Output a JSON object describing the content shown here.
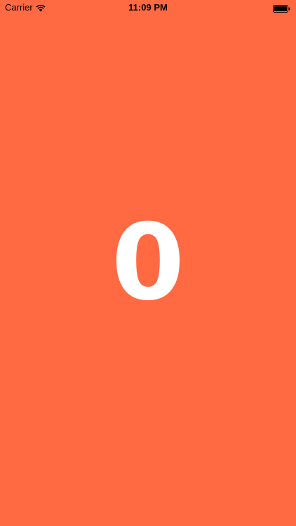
{
  "status_bar": {
    "carrier": "Carrier",
    "time": "11:09 PM",
    "wifi_icon": "wifi-icon",
    "battery_icon": "battery-icon"
  },
  "main": {
    "counter_value": "0"
  },
  "colors": {
    "background": "#FF6A42",
    "counter_text": "#FFFFFF",
    "status_text": "#000000"
  }
}
